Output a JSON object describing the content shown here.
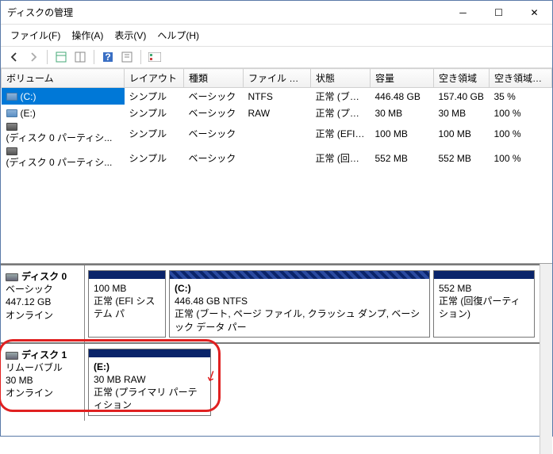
{
  "window": {
    "title": "ディスクの管理"
  },
  "menu": {
    "file": "ファイル(F)",
    "action": "操作(A)",
    "view": "表示(V)",
    "help": "ヘルプ(H)"
  },
  "columns": {
    "volume": "ボリューム",
    "layout": "レイアウト",
    "type": "種類",
    "fs": "ファイル システム",
    "status": "状態",
    "capacity": "容量",
    "free": "空き領域",
    "pct": "空き領域の割..."
  },
  "rows": [
    {
      "name": "(C:)",
      "icon": "drive",
      "selected": true,
      "layout": "シンプル",
      "type": "ベーシック",
      "fs": "NTFS",
      "status": "正常 (ブート...",
      "cap": "446.48 GB",
      "free": "157.40 GB",
      "pct": "35 %"
    },
    {
      "name": "(E:)",
      "icon": "drive",
      "selected": false,
      "layout": "シンプル",
      "type": "ベーシック",
      "fs": "RAW",
      "status": "正常 (プラ...",
      "cap": "30 MB",
      "free": "30 MB",
      "pct": "100 %"
    },
    {
      "name": "(ディスク 0 パーティシ...",
      "icon": "part",
      "selected": false,
      "layout": "シンプル",
      "type": "ベーシック",
      "fs": "",
      "status": "正常 (EFI ...",
      "cap": "100 MB",
      "free": "100 MB",
      "pct": "100 %"
    },
    {
      "name": "(ディスク 0 パーティシ...",
      "icon": "part",
      "selected": false,
      "layout": "シンプル",
      "type": "ベーシック",
      "fs": "",
      "status": "正常 (回復...",
      "cap": "552 MB",
      "free": "552 MB",
      "pct": "100 %"
    }
  ],
  "disk0": {
    "name": "ディスク 0",
    "kind": "ベーシック",
    "size": "447.12 GB",
    "status": "オンライン",
    "p1": {
      "size": "100 MB",
      "status": "正常 (EFI システム パ"
    },
    "p2": {
      "name": "(C:)",
      "size": "446.48 GB NTFS",
      "status": "正常 (ブート, ページ ファイル, クラッシュ ダンプ, ベーシック データ パー"
    },
    "p3": {
      "size": "552 MB",
      "status": "正常 (回復パーティション)"
    }
  },
  "disk1": {
    "name": "ディスク 1",
    "kind": "リムーバブル",
    "size": "30 MB",
    "status": "オンライン",
    "p1": {
      "name": "(E:)",
      "size": "30 MB RAW",
      "status": "正常 (プライマリ パーティション"
    }
  }
}
